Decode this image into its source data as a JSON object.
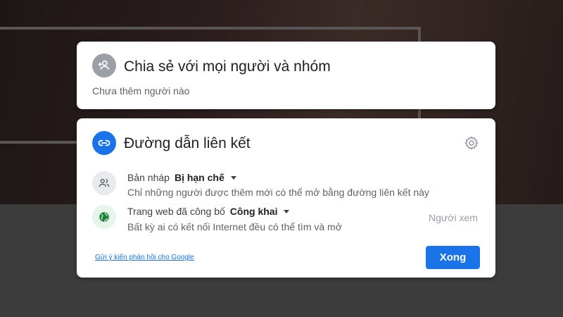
{
  "share_card": {
    "title": "Chia sẻ với mọi người và nhóm",
    "subtitle": "Chưa thêm người nào",
    "icon": "add-person-icon"
  },
  "link_card": {
    "title": "Đường dẫn liên kết",
    "icon": "link-icon",
    "settings_icon": "gear-icon",
    "draft": {
      "label": "Bản nháp",
      "value": "Bị hạn chế",
      "description": "Chỉ những người được thêm mới có thể mở bằng đường liên kết này",
      "icon": "people-icon"
    },
    "published": {
      "label": "Trang web đã công bố",
      "value": "Công khai",
      "description": "Bất kỳ ai có kết nối Internet đều có thể tìm và mở",
      "role": "Người xem",
      "icon": "globe-icon"
    },
    "feedback_link": "Gửi ý kiến phản hồi cho Google",
    "done_label": "Xong"
  },
  "colors": {
    "accent": "#1a73e8",
    "globe": "#188038",
    "muted_icon_bg": "#9aa0a6"
  }
}
